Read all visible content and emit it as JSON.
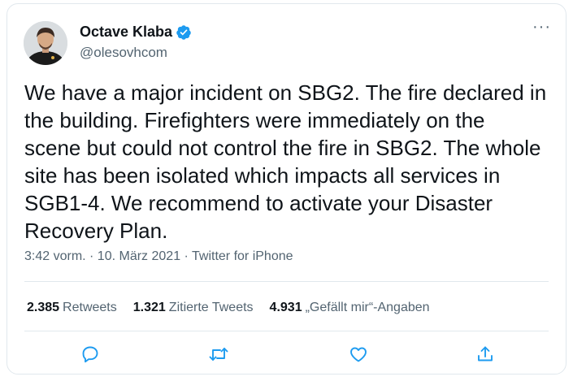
{
  "author": {
    "display_name": "Octave Klaba",
    "handle": "@olesovhcom",
    "verified": true
  },
  "tweet": {
    "text": "We have a major incident on SBG2. The fire declared in\nthe building. Firefighters were immediately on the\nscene but could not control the fire in SBG2. The whole\nsite has been isolated which impacts all services in\nSGB1-4. We recommend to activate your Disaster\nRecovery Plan.",
    "meta": "3:42 vorm. · 10. März 2021 · Twitter for iPhone"
  },
  "stats": [
    {
      "count": "2.385",
      "label": "Retweets"
    },
    {
      "count": "1.321",
      "label": "Zitierte Tweets"
    },
    {
      "count": "4.931",
      "label": "„Gefällt mir“-Angaben"
    }
  ],
  "actions": [
    {
      "icon": "reply-icon"
    },
    {
      "icon": "retweet-icon"
    },
    {
      "icon": "like-icon"
    },
    {
      "icon": "share-icon"
    }
  ],
  "more_label": "···",
  "colors": {
    "text": "#0f1419",
    "muted": "#536471",
    "verified": "#1d9bf0",
    "action_icon": "#1d9bf0",
    "border": "#e1e8ed"
  }
}
